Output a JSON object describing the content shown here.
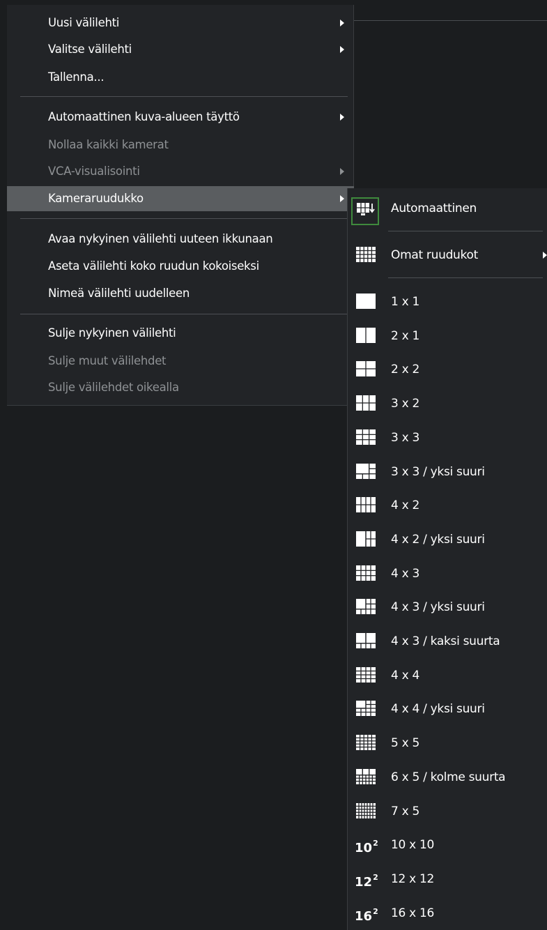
{
  "colors": {
    "background": "#1b1d1f",
    "menu_bg": "#222427",
    "active_bg": "#5a5d60",
    "disabled_text": "#8e9194",
    "selected_frame": "#3f8a3d"
  },
  "menu": {
    "items": [
      {
        "label": "Uusi välilehti",
        "submenu": true,
        "enabled": true
      },
      {
        "label": "Valitse välilehti",
        "submenu": true,
        "enabled": true
      },
      {
        "label": "Tallenna...",
        "submenu": false,
        "enabled": true
      },
      {
        "label": "Automaattinen kuva-alueen täyttö",
        "submenu": true,
        "enabled": true
      },
      {
        "label": "Nollaa kaikki kamerat",
        "submenu": false,
        "enabled": false
      },
      {
        "label": "VCA-visualisointi",
        "submenu": true,
        "enabled": false
      },
      {
        "label": "Kameraruudukko",
        "submenu": true,
        "enabled": true,
        "active": true
      },
      {
        "label": "Avaa nykyinen välilehti uuteen ikkunaan",
        "submenu": false,
        "enabled": true
      },
      {
        "label": "Aseta välilehti koko ruudun kokoiseksi",
        "submenu": false,
        "enabled": true
      },
      {
        "label": "Nimeä välilehti uudelleen",
        "submenu": false,
        "enabled": true
      },
      {
        "label": "Sulje nykyinen välilehti",
        "submenu": false,
        "enabled": true
      },
      {
        "label": "Sulje muut välilehdet",
        "submenu": false,
        "enabled": false
      },
      {
        "label": "Sulje välilehdet oikealla",
        "submenu": false,
        "enabled": false
      }
    ]
  },
  "submenu": {
    "items": [
      {
        "label": "Automaattinen",
        "icon": "auto-grid-icon",
        "selected": true
      },
      {
        "label": "Omat ruudukot",
        "icon": "custom-grid-icon",
        "submenu": true
      },
      {
        "label": "1 x 1",
        "icon": "grid-1x1-icon"
      },
      {
        "label": "2 x 1",
        "icon": "grid-2x1-icon"
      },
      {
        "label": "2 x 2",
        "icon": "grid-2x2-icon"
      },
      {
        "label": "3 x 2",
        "icon": "grid-3x2-icon"
      },
      {
        "label": "3 x 3",
        "icon": "grid-3x3-icon"
      },
      {
        "label": "3 x 3 / yksi suuri",
        "icon": "grid-3x3-one-large-icon"
      },
      {
        "label": "4 x 2",
        "icon": "grid-4x2-icon"
      },
      {
        "label": "4 x 2 / yksi suuri",
        "icon": "grid-4x2-one-large-icon"
      },
      {
        "label": "4 x 3",
        "icon": "grid-4x3-icon"
      },
      {
        "label": "4 x 3 / yksi suuri",
        "icon": "grid-4x3-one-large-icon"
      },
      {
        "label": "4 x 3 / kaksi suurta",
        "icon": "grid-4x3-two-large-icon"
      },
      {
        "label": "4 x 4",
        "icon": "grid-4x4-icon"
      },
      {
        "label": "4 x 4 / yksi suuri",
        "icon": "grid-4x4-one-large-icon"
      },
      {
        "label": "5 x 5",
        "icon": "grid-5x5-icon"
      },
      {
        "label": "6 x 5 / kolme suurta",
        "icon": "grid-6x5-three-large-icon"
      },
      {
        "label": "7 x 5",
        "icon": "grid-7x5-icon"
      },
      {
        "label": "10 x 10",
        "icon": "grid-10x10-icon",
        "icon_text": "10",
        "icon_sup": "2"
      },
      {
        "label": "12 x 12",
        "icon": "grid-12x12-icon",
        "icon_text": "12",
        "icon_sup": "2"
      },
      {
        "label": "16 x 16",
        "icon": "grid-16x16-icon",
        "icon_text": "16",
        "icon_sup": "2"
      }
    ]
  }
}
